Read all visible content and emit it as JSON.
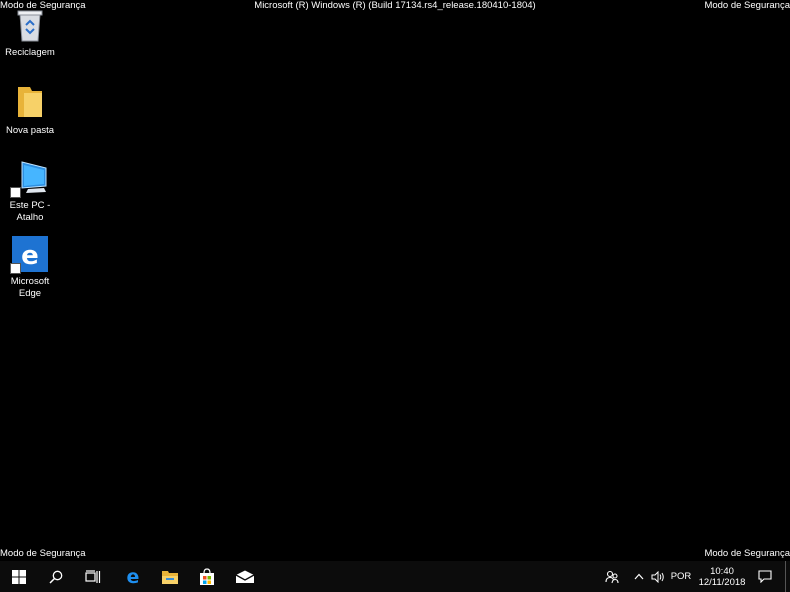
{
  "overlay": {
    "top_left": "Modo de Segurança",
    "top_right": "Modo de Segurança",
    "top_center": "Microsoft (R) Windows (R) (Build 17134.rs4_release.180410-1804)",
    "bottom_left": "Modo de Segurança",
    "bottom_right": "Modo de Segurança"
  },
  "desktop": {
    "icons": [
      {
        "label": "Reciclagem",
        "icon": "recycle-bin-icon"
      },
      {
        "label": "Nova pasta",
        "icon": "folder-icon"
      },
      {
        "label": "Este PC - Atalho",
        "icon": "computer-icon"
      },
      {
        "label": "Microsoft Edge",
        "icon": "edge-icon"
      }
    ]
  },
  "taskbar": {
    "buttons": [
      {
        "icon": "windows-start-icon"
      },
      {
        "icon": "search-icon"
      },
      {
        "icon": "task-view-icon"
      },
      {
        "icon": "edge-icon"
      },
      {
        "icon": "file-explorer-icon"
      },
      {
        "icon": "store-icon"
      },
      {
        "icon": "mail-icon"
      }
    ],
    "tray": {
      "language": "POR",
      "time": "10:40",
      "date": "12/11/2018"
    }
  },
  "colors": {
    "desktop_background": "#000000",
    "taskbar_background": "#0c0c0c",
    "edge_blue": "#1e73d2",
    "folder_yellow": "#f4c44a",
    "text": "#ffffff"
  }
}
